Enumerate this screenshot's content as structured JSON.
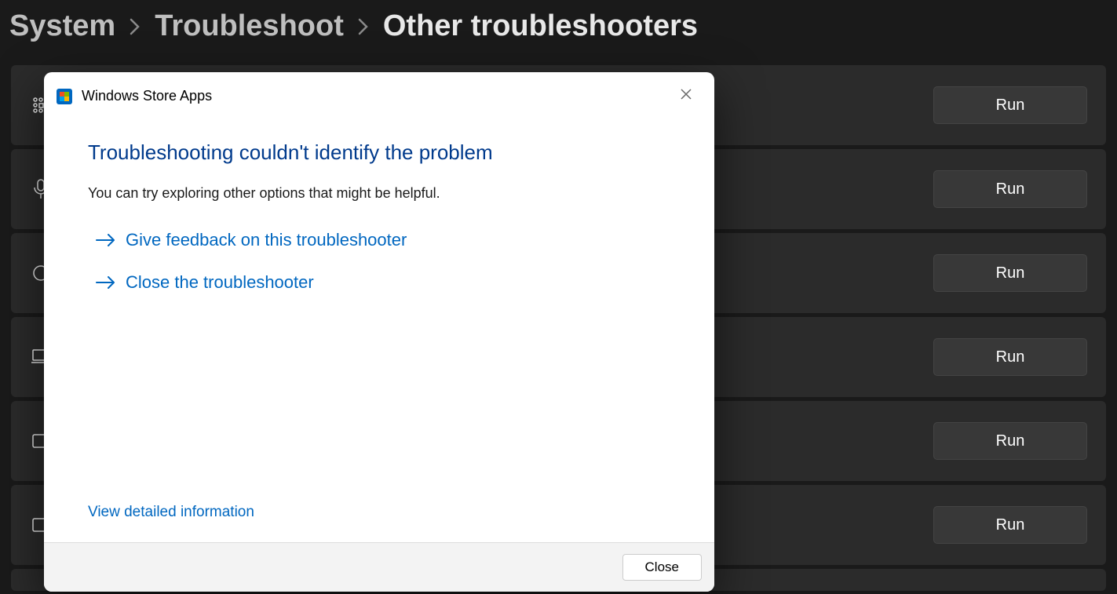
{
  "breadcrumb": {
    "system": "System",
    "troubleshoot": "Troubleshoot",
    "other": "Other troubleshooters"
  },
  "troubleshooters": {
    "run_label": "Run"
  },
  "dialog": {
    "app_title": "Windows Store Apps",
    "heading": "Troubleshooting couldn't identify the problem",
    "subtext": "You can try exploring other options that might be helpful.",
    "action_feedback": "Give feedback on this troubleshooter",
    "action_close": "Close the troubleshooter",
    "detail_link": "View detailed information",
    "close_button": "Close"
  }
}
